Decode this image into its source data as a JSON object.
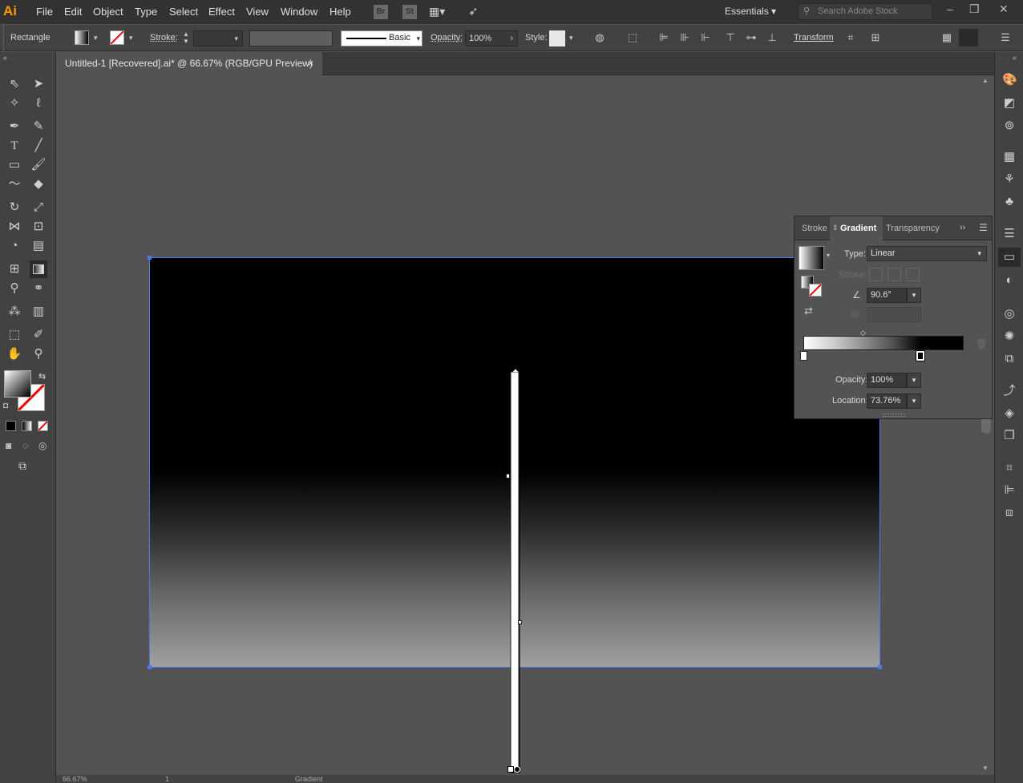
{
  "app": {
    "logo": "Ai",
    "menu": [
      "File",
      "Edit",
      "Object",
      "Type",
      "Select",
      "Effect",
      "View",
      "Window",
      "Help"
    ],
    "bridge_icon": "Br",
    "stock_icon": "St",
    "workspace": "Essentials",
    "search_placeholder": "Search Adobe Stock"
  },
  "control_bar": {
    "selection_type": "Rectangle",
    "stroke_label": "Stroke:",
    "brush_label": "Basic",
    "opacity_label": "Opacity:",
    "opacity_value": "100%",
    "style_label": "Style:",
    "transform_label": "Transform"
  },
  "document": {
    "tab_title": "Untitled-1 [Recovered].ai* @ 66.67% (RGB/GPU Preview)",
    "close_glyph": "×"
  },
  "gradient_panel": {
    "tabs": [
      "Stroke",
      "Gradient",
      "Transparency"
    ],
    "active_tab": "Gradient",
    "type_label": "Type:",
    "type_value": "Linear",
    "stroke_label": "Stroke:",
    "angle_value": "90.6°",
    "opacity_label": "Opacity:",
    "opacity_value": "100%",
    "location_label": "Location:",
    "location_value": "73.76%",
    "gradient_stops": [
      {
        "color": "#ffffff",
        "location": 0
      },
      {
        "color": "#000000",
        "location": 73.76
      }
    ]
  },
  "status_bar": {
    "zoom": "66.67%",
    "artboard_number": "1",
    "active_tool": "Gradient"
  },
  "colors": {
    "selection_blue": "#4b7bec",
    "brand_orange": "#ff9a00"
  }
}
